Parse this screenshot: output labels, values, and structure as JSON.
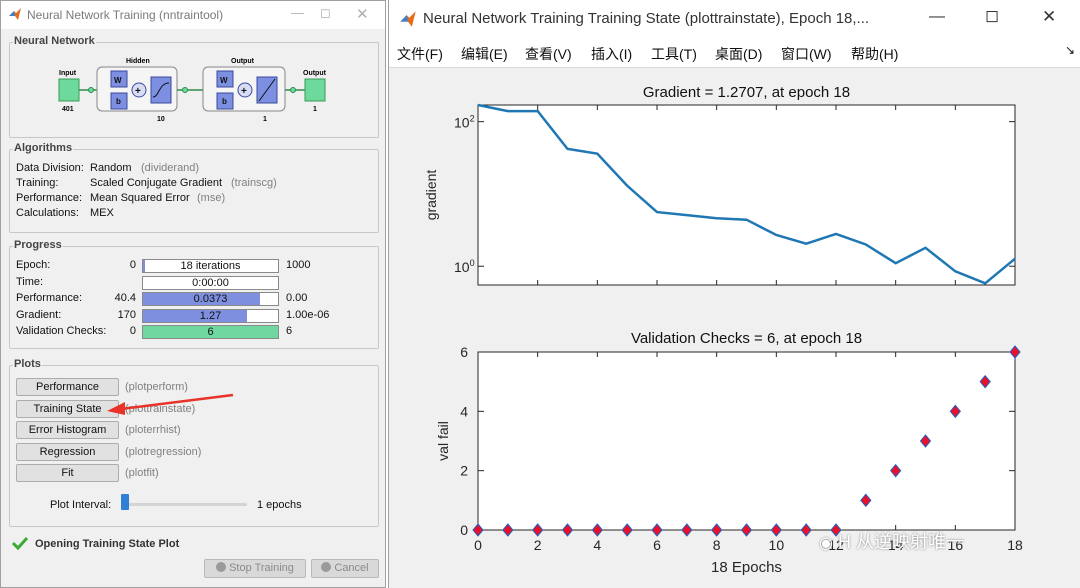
{
  "left_window": {
    "title": "Neural Network Training (nntraintool)",
    "network_group": "Neural Network",
    "diagram": {
      "input_label": "Input",
      "input_size": "401",
      "hidden_label": "Hidden",
      "hidden_size": "10",
      "output_layer_label": "Output",
      "output_layer_size": "1",
      "output_label": "Output",
      "output_size": "1",
      "w": "W",
      "b": "b",
      "plus": "+"
    },
    "algorithms_group": "Algorithms",
    "algorithms": [
      {
        "label": "Data Division:",
        "value": "Random",
        "fn": "(dividerand)"
      },
      {
        "label": "Training:",
        "value": "Scaled Conjugate Gradient",
        "fn": "(trainscg)"
      },
      {
        "label": "Performance:",
        "value": "Mean Squared Error",
        "fn": "(mse)"
      },
      {
        "label": "Calculations:",
        "value": "MEX",
        "fn": ""
      }
    ],
    "progress_group": "Progress",
    "progress": [
      {
        "label": "Epoch:",
        "start": "0",
        "text": "18 iterations",
        "end": "1000",
        "fraction": 0.018,
        "color": "#7f8fe0"
      },
      {
        "label": "Time:",
        "start": "",
        "text": "0:00:00",
        "end": "",
        "fraction": 0,
        "color": "#7f8fe0"
      },
      {
        "label": "Performance:",
        "start": "40.4",
        "text": "0.0373",
        "end": "0.00",
        "fraction": 0.87,
        "color": "#7f8fe0"
      },
      {
        "label": "Gradient:",
        "start": "170",
        "text": "1.27",
        "end": "1.00e-06",
        "fraction": 0.77,
        "color": "#7f8fe0"
      },
      {
        "label": "Validation Checks:",
        "start": "0",
        "text": "6",
        "end": "6",
        "fraction": 1.0,
        "color": "#6fd8a0"
      }
    ],
    "plots_group": "Plots",
    "plots": [
      {
        "label": "Performance",
        "fn": "(plotperform)"
      },
      {
        "label": "Training State",
        "fn": "(plottrainstate)"
      },
      {
        "label": "Error Histogram",
        "fn": "(ploterrhist)"
      },
      {
        "label": "Regression",
        "fn": "(plotregression)"
      },
      {
        "label": "Fit",
        "fn": "(plotfit)"
      }
    ],
    "plot_interval_label": "Plot Interval:",
    "plot_interval_value": "1 epochs",
    "plot_interval_fraction": 0.0,
    "status_text": "Opening Training State Plot",
    "stop_button": "Stop Training",
    "cancel_button": "Cancel",
    "colors": {
      "arrow": "#e8332a",
      "check": "#3aaa35"
    }
  },
  "right_window": {
    "title": "Neural Network Training Training State (plottrainstate), Epoch 18,...",
    "menu": [
      "文件(F)",
      "编辑(E)",
      "查看(V)",
      "插入(I)",
      "工具(T)",
      "桌面(D)",
      "窗口(W)",
      "帮助(H)"
    ],
    "watermark": "H 从逆映射唯一"
  },
  "chart_data": [
    {
      "type": "line",
      "title": "Gradient = 1.2707, at epoch 18",
      "xlabel": "",
      "ylabel": "gradient",
      "yscale": "log",
      "ylim": [
        0.55,
        170
      ],
      "xlim": [
        0,
        18
      ],
      "y_ticks": [
        "10^2",
        "10^0"
      ],
      "x": [
        0,
        1,
        2,
        3,
        4,
        5,
        6,
        7,
        8,
        9,
        10,
        11,
        12,
        13,
        14,
        15,
        16,
        17,
        18
      ],
      "y": [
        170,
        140,
        140,
        42,
        36,
        13,
        5.6,
        5.1,
        4.6,
        4.4,
        2.7,
        2.05,
        2.8,
        2.0,
        1.1,
        1.8,
        0.85,
        0.58,
        1.27
      ],
      "color": "#1f77b4",
      "grid": false
    },
    {
      "type": "scatter",
      "title": "Validation Checks = 6, at epoch 18",
      "xlabel": "18 Epochs",
      "ylabel": "val fail",
      "xlim": [
        0,
        18
      ],
      "ylim": [
        0,
        6
      ],
      "x_ticks": [
        "0",
        "2",
        "4",
        "6",
        "8",
        "10",
        "12",
        "14",
        "16",
        "18"
      ],
      "y_ticks": [
        "0",
        "2",
        "4",
        "6"
      ],
      "x": [
        0,
        1,
        2,
        3,
        4,
        5,
        6,
        7,
        8,
        9,
        10,
        11,
        12,
        13,
        14,
        15,
        16,
        17,
        18
      ],
      "y": [
        0,
        0,
        0,
        0,
        0,
        0,
        0,
        0,
        0,
        0,
        0,
        0,
        0,
        1,
        2,
        3,
        4,
        5,
        6
      ],
      "marker_color": "#e8102a",
      "edge_color": "#2160c0",
      "grid": false
    }
  ]
}
